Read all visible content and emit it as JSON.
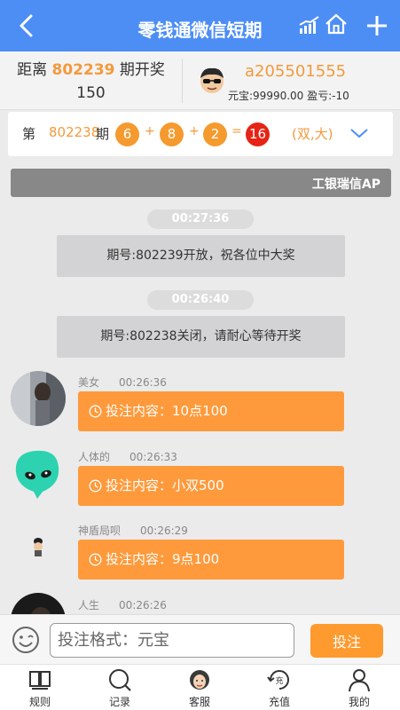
{
  "header": {
    "title": "零钱通微信短期"
  },
  "countdown": {
    "prefix": "距离",
    "issue": "802239",
    "suffix": "期开奖",
    "seconds": "150"
  },
  "user": {
    "name": "a205501555",
    "balance_label": "元宝:99990.00 盈亏:-10"
  },
  "last_result": {
    "prefix": "第",
    "issue": "802238",
    "suffix": "期",
    "balls": [
      "6",
      "8",
      "2"
    ],
    "sum": "16",
    "plus": "+",
    "equals": "=",
    "tag": "(双,大)"
  },
  "notice": {
    "text": "工银瑞信AP"
  },
  "system_messages": [
    {
      "time": "00:27:36",
      "text": "期号:802239开放，祝各位中大奖"
    },
    {
      "time": "00:26:40",
      "text": "期号:802238关闭，请耐心等待开奖"
    }
  ],
  "bet_messages": [
    {
      "nickname": "美女",
      "time": "00:26:36",
      "content": "投注内容：10点100"
    },
    {
      "nickname": "人体的",
      "time": "00:26:33",
      "content": "投注内容：小双500"
    },
    {
      "nickname": "神盾局呗",
      "time": "00:26:29",
      "content": "投注内容：9点100"
    },
    {
      "nickname": "人生",
      "time": "00:26:26"
    }
  ],
  "input": {
    "placeholder": "投注格式：元宝",
    "submit_label": "投注"
  },
  "tabs": [
    {
      "label": "规则",
      "icon": "book-icon"
    },
    {
      "label": "记录",
      "icon": "search-icon"
    },
    {
      "label": "客服",
      "icon": "support-avatar-icon"
    },
    {
      "label": "充值",
      "icon": "recharge-icon"
    },
    {
      "label": "我的",
      "icon": "user-icon"
    }
  ],
  "colors": {
    "header": "#4d8ef5",
    "accent": "#f39a3c",
    "bubble": "#fe9a3b",
    "sum_ball": "#e62314"
  }
}
